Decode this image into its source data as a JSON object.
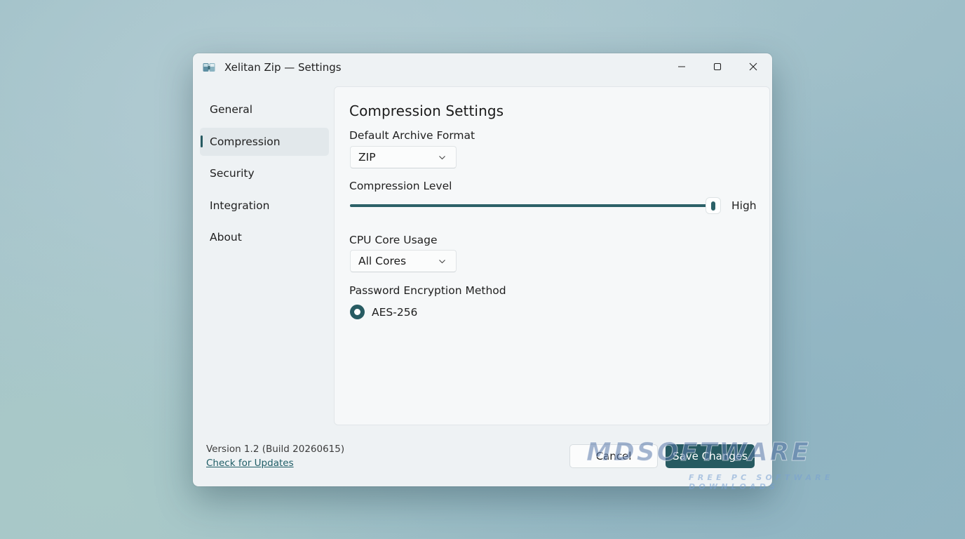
{
  "window": {
    "title": "Xelitan Zip — Settings",
    "app_icon": "zip-app-icon",
    "controls": {
      "minimize": "minimize-icon",
      "maximize": "maximize-icon",
      "close": "close-icon"
    }
  },
  "sidebar": {
    "items": [
      {
        "label": "General",
        "active": false
      },
      {
        "label": "Compression",
        "active": true
      },
      {
        "label": "Security",
        "active": false
      },
      {
        "label": "Integration",
        "active": false
      },
      {
        "label": "About",
        "active": false
      }
    ],
    "version": "Version 1.2 (Build 20260615)",
    "update_link": "Check for Updates"
  },
  "main": {
    "heading": "Compression Settings",
    "archive_format": {
      "label": "Default Archive Format",
      "value": "ZIP"
    },
    "compression_level": {
      "label": "Compression Level",
      "value_label": "High",
      "level": 1.0
    },
    "cpu_usage": {
      "label": "CPU Core Usage",
      "value": "All Cores"
    },
    "encryption": {
      "label": "Password Encryption Method",
      "option": "AES-256",
      "selected": true
    }
  },
  "footer": {
    "cancel_label": "Cancel",
    "save_label": "Save Changes"
  },
  "watermark": {
    "main": "MDSOFTWARE",
    "sub": "FREE PC SOFTWARE DOWNLOADS"
  },
  "colors": {
    "accent": "#265a61",
    "window_bg": "#eef2f4",
    "content_bg": "#f6f8f9"
  }
}
